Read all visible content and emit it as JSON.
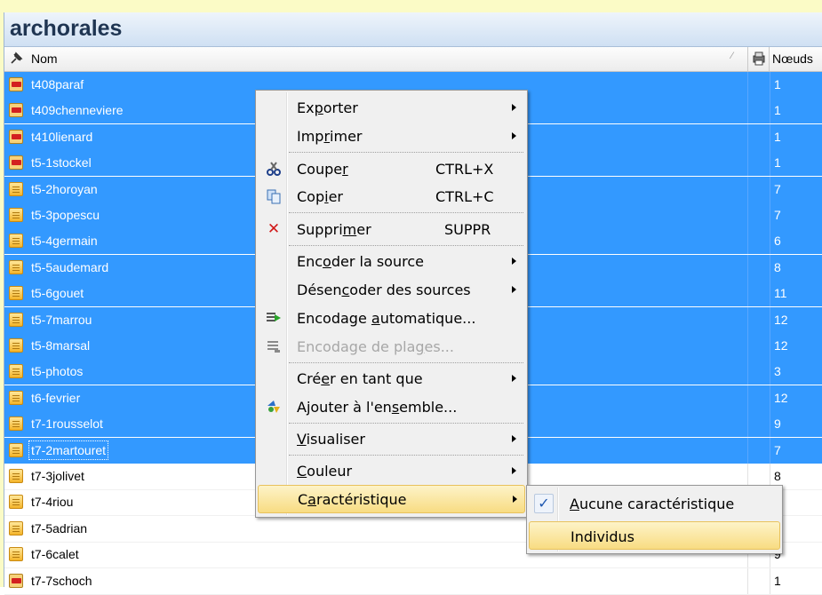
{
  "window": {
    "title": "archorales"
  },
  "columns": {
    "name": "Nom",
    "nodes": "Nœuds"
  },
  "rows": [
    {
      "name": "t408paraf",
      "nodes": "1",
      "icon": "pdf-icon",
      "selected": true
    },
    {
      "name": "t409chenneviere",
      "nodes": "1",
      "icon": "pdf-icon",
      "selected": true
    },
    {
      "name": "t410lienard",
      "nodes": "1",
      "icon": "pdf-icon",
      "selected": true
    },
    {
      "name": "t5-1stockel",
      "nodes": "1",
      "icon": "pdf-icon",
      "selected": true
    },
    {
      "name": "t5-2horoyan",
      "nodes": "7",
      "icon": "document-icon",
      "selected": true
    },
    {
      "name": "t5-3popescu",
      "nodes": "7",
      "icon": "document-icon",
      "selected": true
    },
    {
      "name": "t5-4germain",
      "nodes": "6",
      "icon": "document-icon",
      "selected": true
    },
    {
      "name": "t5-5audemard",
      "nodes": "8",
      "icon": "document-icon",
      "selected": true
    },
    {
      "name": "t5-6gouet",
      "nodes": "11",
      "icon": "document-icon",
      "selected": true
    },
    {
      "name": "t5-7marrou",
      "nodes": "12",
      "icon": "document-icon",
      "selected": true
    },
    {
      "name": "t5-8marsal",
      "nodes": "12",
      "icon": "document-icon",
      "selected": true
    },
    {
      "name": "t5-photos",
      "nodes": "3",
      "icon": "document-icon",
      "selected": true
    },
    {
      "name": "t6-fevrier",
      "nodes": "12",
      "icon": "document-icon",
      "selected": true
    },
    {
      "name": "t7-1rousselot",
      "nodes": "9",
      "icon": "document-icon",
      "selected": true
    },
    {
      "name": "t7-2martouret",
      "nodes": "7",
      "icon": "document-icon",
      "selected": true
    },
    {
      "name": "t7-3jolivet",
      "nodes": "8",
      "icon": "document-icon",
      "selected": false
    },
    {
      "name": "t7-4riou",
      "nodes": "",
      "icon": "document-icon",
      "selected": false
    },
    {
      "name": "t7-5adrian",
      "nodes": "",
      "icon": "document-icon",
      "selected": false
    },
    {
      "name": "t7-6calet",
      "nodes": "9",
      "icon": "document-icon",
      "selected": false
    },
    {
      "name": "t7-7schoch",
      "nodes": "1",
      "icon": "pdf-icon",
      "selected": false
    }
  ],
  "menu": {
    "export": {
      "pre": "Ex",
      "u": "p",
      "post": "orter"
    },
    "print": {
      "pre": "Imp",
      "u": "r",
      "post": "imer"
    },
    "cut": {
      "pre": "Coupe",
      "u": "r",
      "post": "",
      "shortcut": "CTRL+X"
    },
    "copy": {
      "pre": "Cop",
      "u": "i",
      "post": "er",
      "shortcut": "CTRL+C"
    },
    "delete": {
      "pre": "Suppri",
      "u": "m",
      "post": "er",
      "shortcut": "SUPPR"
    },
    "encode_source": {
      "pre": "Enc",
      "u": "o",
      "post": "der la source"
    },
    "decode_sources": {
      "pre": "Désen",
      "u": "c",
      "post": "oder des sources"
    },
    "auto_encoding": {
      "pre": "Encodage ",
      "u": "a",
      "post": "utomatique..."
    },
    "range_encoding": {
      "pre": "Encodage de pla",
      "u": "g",
      "post": "es..."
    },
    "create_as": {
      "pre": "Cré",
      "u": "e",
      "post": "r en tant que"
    },
    "add_to_set": {
      "pre": "Ajouter à l'en",
      "u": "s",
      "post": "emble..."
    },
    "visualize": {
      "pre": "",
      "u": "V",
      "post": "isualiser"
    },
    "color": {
      "pre": "",
      "u": "C",
      "post": "ouleur"
    },
    "characteristic": {
      "pre": "C",
      "u": "a",
      "post": "ractéristique"
    }
  },
  "submenu": {
    "none": {
      "pre": "",
      "u": "A",
      "post": "ucune caractéristique"
    },
    "individuals": "Individus"
  }
}
